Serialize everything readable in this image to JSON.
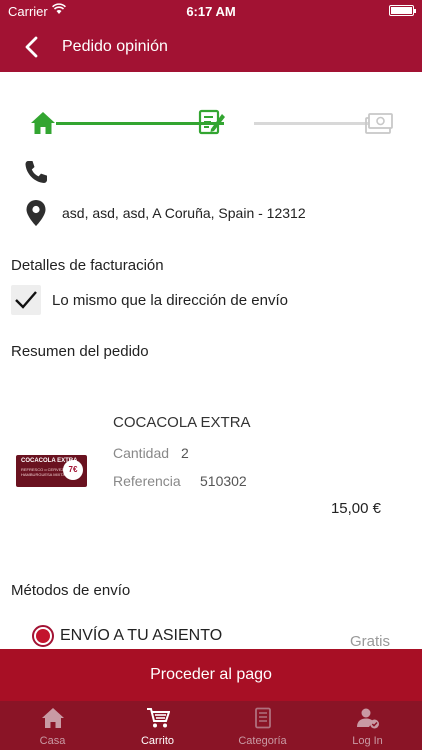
{
  "status_bar": {
    "carrier": "Carrier",
    "time": "6:17 AM"
  },
  "nav": {
    "title": "Pedido opinión"
  },
  "steps": {
    "active_color": "#33a531",
    "inactive_color": "#d8d8d8"
  },
  "contact": {
    "address": "asd, asd, asd, A Coruña, Spain - 12312"
  },
  "billing": {
    "heading": "Detalles de facturación",
    "same_as_shipping": "Lo mismo que la dirección de envío",
    "checked": true
  },
  "summary": {
    "heading": "Resumen del pedido",
    "item": {
      "name": "COCACOLA EXTRA",
      "quantity_label": "Cantidad",
      "quantity": "2",
      "reference_label": "Referencia",
      "reference": "510302",
      "price": "15,00 €",
      "thumb_title": "COCACOLA EXTRA",
      "thumb_subtitle": "REFRESCO o CERVEZA · HAMBURGUESA MIXTA",
      "thumb_badge": "7€"
    }
  },
  "shipping": {
    "heading": "Métodos de envío",
    "option": "ENVÍO A TU ASIENTO",
    "option_price": "Gratis"
  },
  "pay_button": "Proceder al pago",
  "tabs": [
    {
      "label": "Casa",
      "icon": "home-icon"
    },
    {
      "label": "Carrito",
      "icon": "cart-icon"
    },
    {
      "label": "Categoría",
      "icon": "list-icon"
    },
    {
      "label": "Log In",
      "icon": "user-icon"
    }
  ],
  "colors": {
    "brand": "#a21233",
    "pay_button": "#a80f25",
    "tabbar": "#8a1426"
  }
}
